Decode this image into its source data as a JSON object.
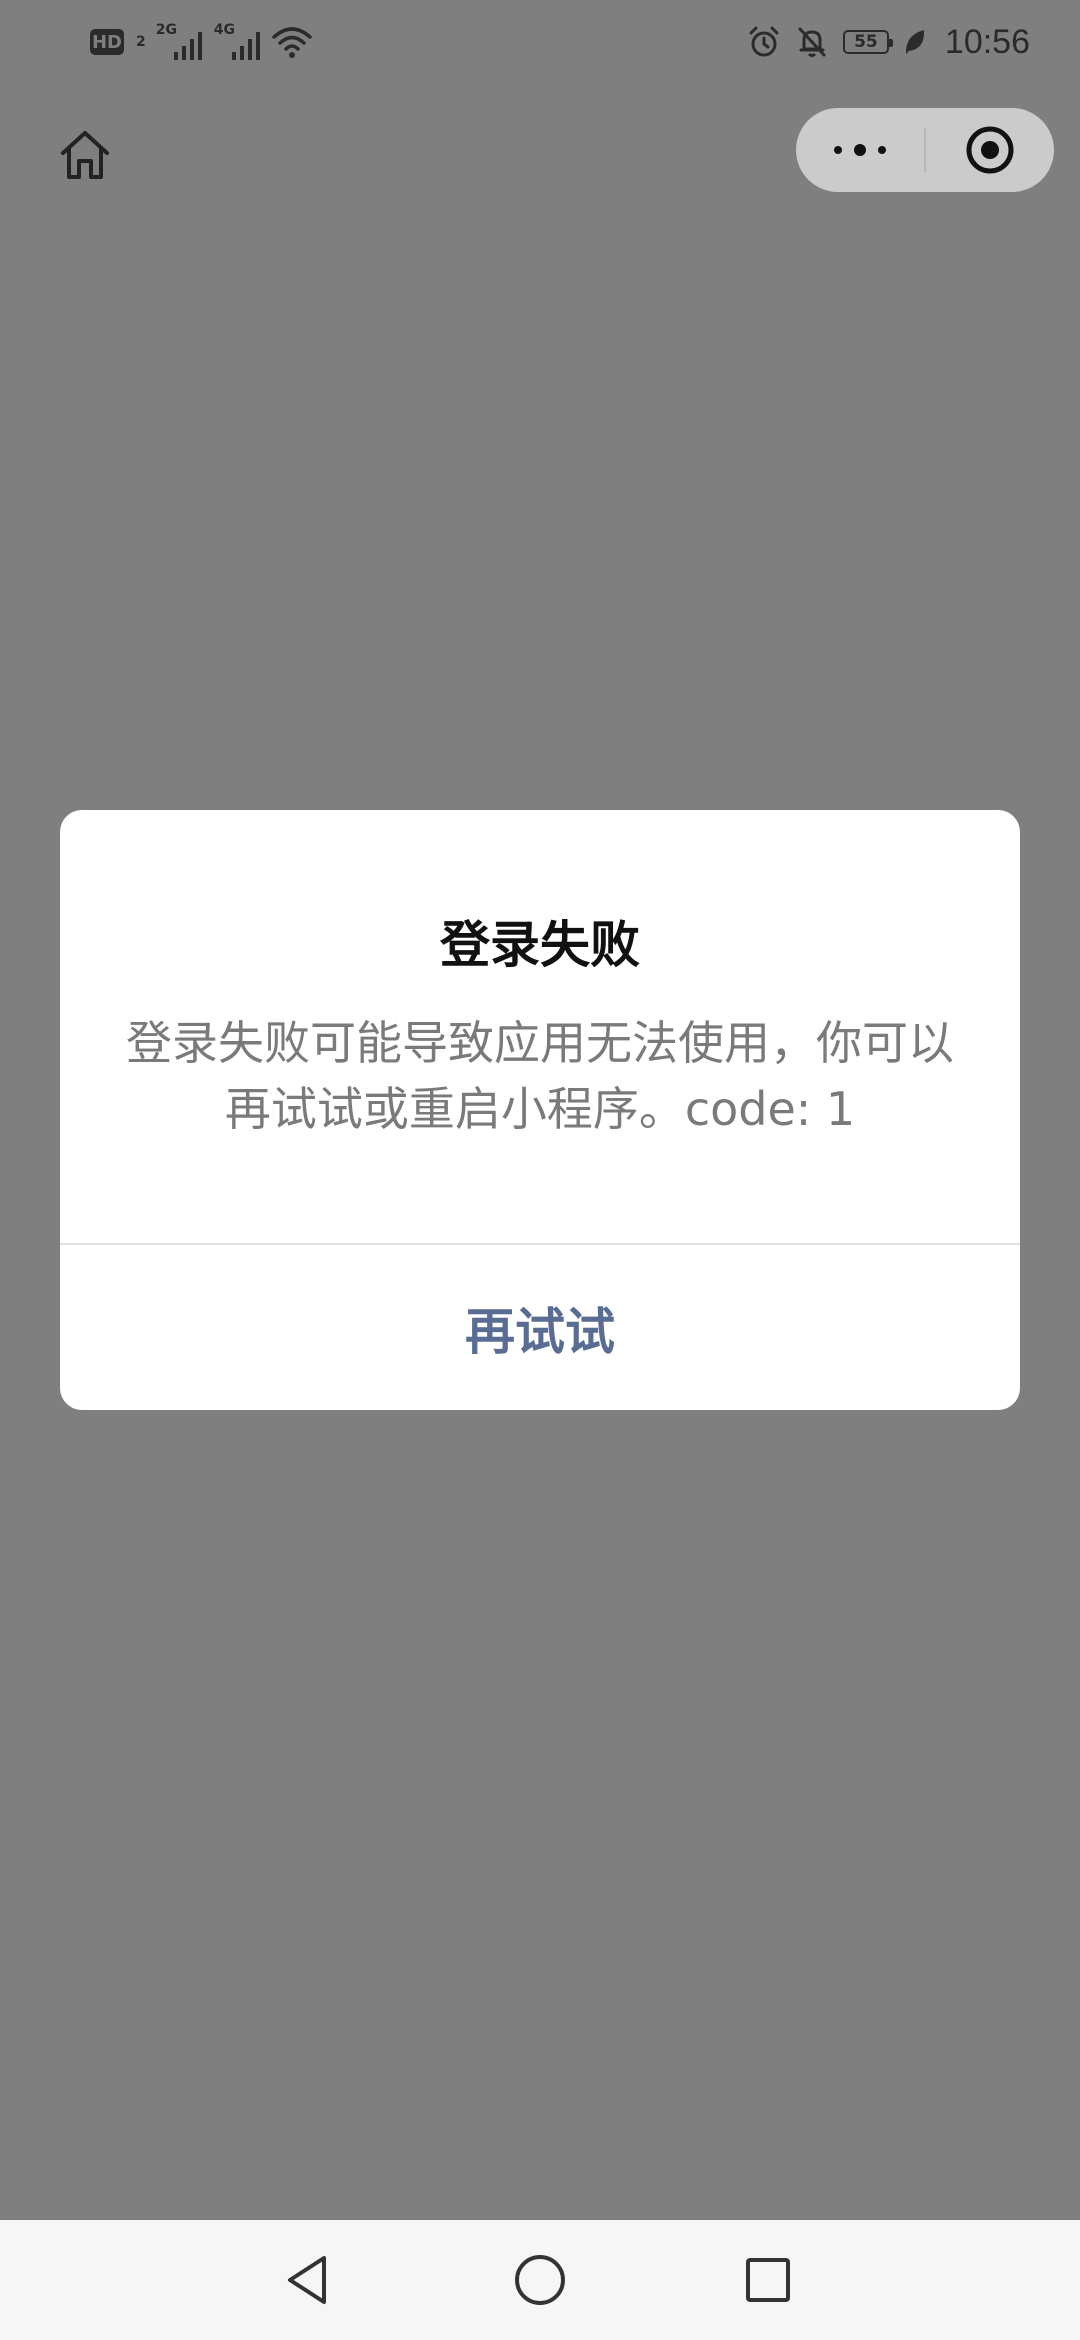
{
  "status_bar": {
    "hd_label": "HD",
    "hd_sub": "2",
    "signal1_tag": "2G",
    "signal2_tag": "4G",
    "battery_level": "55",
    "time": "10:56"
  },
  "nav": {
    "home_icon": "home-icon",
    "more_icon": "more-dots-icon",
    "close_icon": "target-close-icon"
  },
  "dialog": {
    "title": "登录失败",
    "message": "登录失败可能导致应用无法使用，你可以再试试或重启小程序。code: 1",
    "retry_label": "再试试"
  },
  "colors": {
    "overlay": "#7f7f7f",
    "dialog_bg": "#ffffff",
    "title": "#111111",
    "message": "#7a7a7a",
    "button": "#586c94",
    "capsule": "#cbcbcb",
    "navbar": "#f6f6f6"
  },
  "system_nav": {
    "back_icon": "back-triangle-icon",
    "home_icon": "home-circle-icon",
    "recents_icon": "recents-square-icon"
  }
}
